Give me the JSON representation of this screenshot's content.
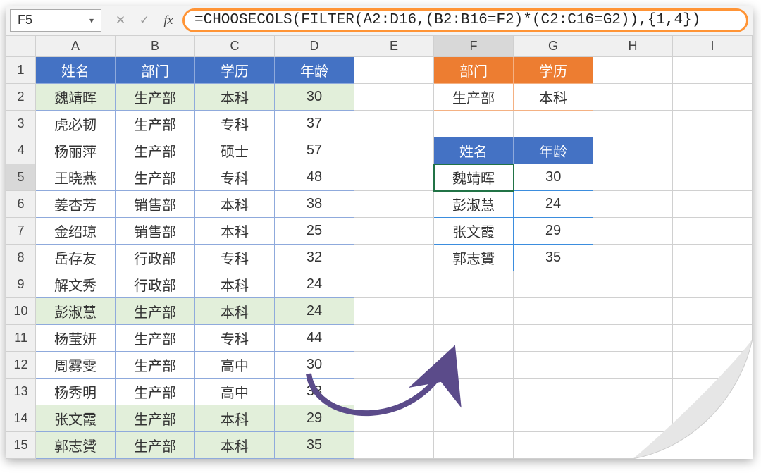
{
  "nameBox": "F5",
  "formula": "=CHOOSECOLS(FILTER(A2:D16,(B2:B16=F2)*(C2:C16=G2)),{1,4})",
  "columns": [
    "A",
    "B",
    "C",
    "D",
    "E",
    "F",
    "G",
    "H",
    "I"
  ],
  "mainHeaders": {
    "A": "姓名",
    "B": "部门",
    "C": "学历",
    "D": "年龄"
  },
  "rows": [
    {
      "n": "魏靖晖",
      "d": "生产部",
      "e": "本科",
      "a": "30",
      "hi": true
    },
    {
      "n": "虎必韧",
      "d": "生产部",
      "e": "专科",
      "a": "37"
    },
    {
      "n": "杨丽萍",
      "d": "生产部",
      "e": "硕士",
      "a": "57"
    },
    {
      "n": "王晓燕",
      "d": "生产部",
      "e": "专科",
      "a": "48"
    },
    {
      "n": "姜杏芳",
      "d": "销售部",
      "e": "本科",
      "a": "38"
    },
    {
      "n": "金绍琼",
      "d": "销售部",
      "e": "本科",
      "a": "25"
    },
    {
      "n": "岳存友",
      "d": "行政部",
      "e": "专科",
      "a": "32"
    },
    {
      "n": "解文秀",
      "d": "行政部",
      "e": "本科",
      "a": "24"
    },
    {
      "n": "彭淑慧",
      "d": "生产部",
      "e": "本科",
      "a": "24",
      "hi": true
    },
    {
      "n": "杨莹妍",
      "d": "生产部",
      "e": "专科",
      "a": "44"
    },
    {
      "n": "周雾雯",
      "d": "生产部",
      "e": "高中",
      "a": "30"
    },
    {
      "n": "杨秀明",
      "d": "生产部",
      "e": "高中",
      "a": "33"
    },
    {
      "n": "张文霞",
      "d": "生产部",
      "e": "本科",
      "a": "29",
      "hi": true
    },
    {
      "n": "郭志贇",
      "d": "生产部",
      "e": "本科",
      "a": "35",
      "hi": true
    }
  ],
  "criteria": {
    "headers": {
      "F": "部门",
      "G": "学历"
    },
    "values": {
      "F": "生产部",
      "G": "本科"
    }
  },
  "result": {
    "headers": {
      "F": "姓名",
      "G": "年龄"
    },
    "rows": [
      {
        "n": "魏靖晖",
        "a": "30"
      },
      {
        "n": "彭淑慧",
        "a": "24"
      },
      {
        "n": "张文霞",
        "a": "29"
      },
      {
        "n": "郭志贇",
        "a": "35"
      }
    ]
  }
}
